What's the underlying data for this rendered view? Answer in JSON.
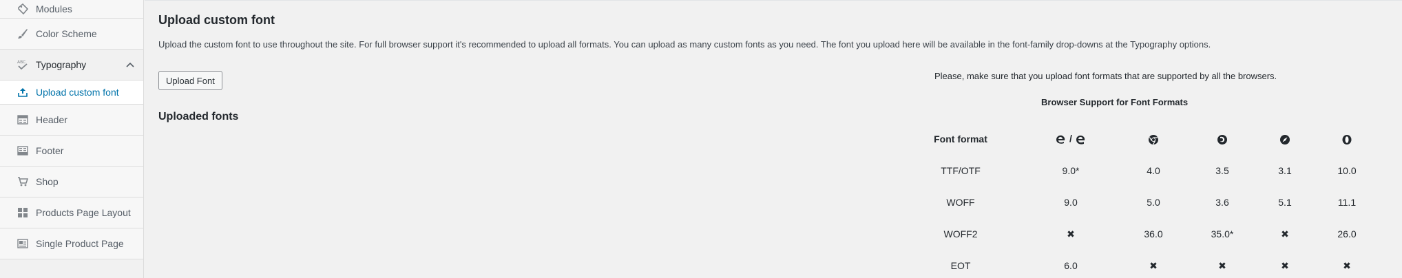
{
  "sidebar": {
    "items_top": [
      {
        "label": "Modules",
        "icon": "tag-icon"
      },
      {
        "label": "Color Scheme",
        "icon": "brush-icon"
      }
    ],
    "active": {
      "label": "Typography",
      "icon": "abc-check-icon"
    },
    "sub": {
      "label": "Upload custom font",
      "icon": "upload-icon"
    },
    "items_bottom": [
      {
        "label": "Header",
        "icon": "header-layout-icon"
      },
      {
        "label": "Footer",
        "icon": "footer-layout-icon"
      },
      {
        "label": "Shop",
        "icon": "cart-icon"
      },
      {
        "label": "Products Page Layout",
        "icon": "grid-icon"
      },
      {
        "label": "Single Product Page",
        "icon": "product-card-icon"
      }
    ]
  },
  "main": {
    "title": "Upload custom font",
    "description": "Upload the custom font to use throughout the site. For full browser support it's recommended to upload all formats. You can upload as many custom fonts as you need. The font you upload here will be available in the font-family drop-downs at the Typography options.",
    "upload_button": "Upload Font",
    "uploaded_title": "Uploaded fonts",
    "notice": "Please, make sure that you upload font formats that are supported by all the browsers.",
    "table_caption": "Browser Support for Font Formats",
    "table": {
      "header": "Font format",
      "browsers": [
        "ie-edge-icon",
        "chrome-icon",
        "firefox-icon",
        "safari-icon",
        "opera-icon"
      ],
      "ie_separator": "/",
      "rows": [
        {
          "format": "TTF/OTF",
          "values": [
            "9.0*",
            "4.0",
            "3.5",
            "3.1",
            "10.0"
          ]
        },
        {
          "format": "WOFF",
          "values": [
            "9.0",
            "5.0",
            "3.6",
            "5.1",
            "11.1"
          ]
        },
        {
          "format": "WOFF2",
          "values": [
            "✖",
            "36.0",
            "35.0*",
            "✖",
            "26.0"
          ]
        },
        {
          "format": "EOT",
          "values": [
            "6.0",
            "✖",
            "✖",
            "✖",
            "✖"
          ]
        }
      ]
    }
  },
  "colors": {
    "accent": "#0073aa",
    "background": "#f1f1f1",
    "text": "#23282d"
  }
}
